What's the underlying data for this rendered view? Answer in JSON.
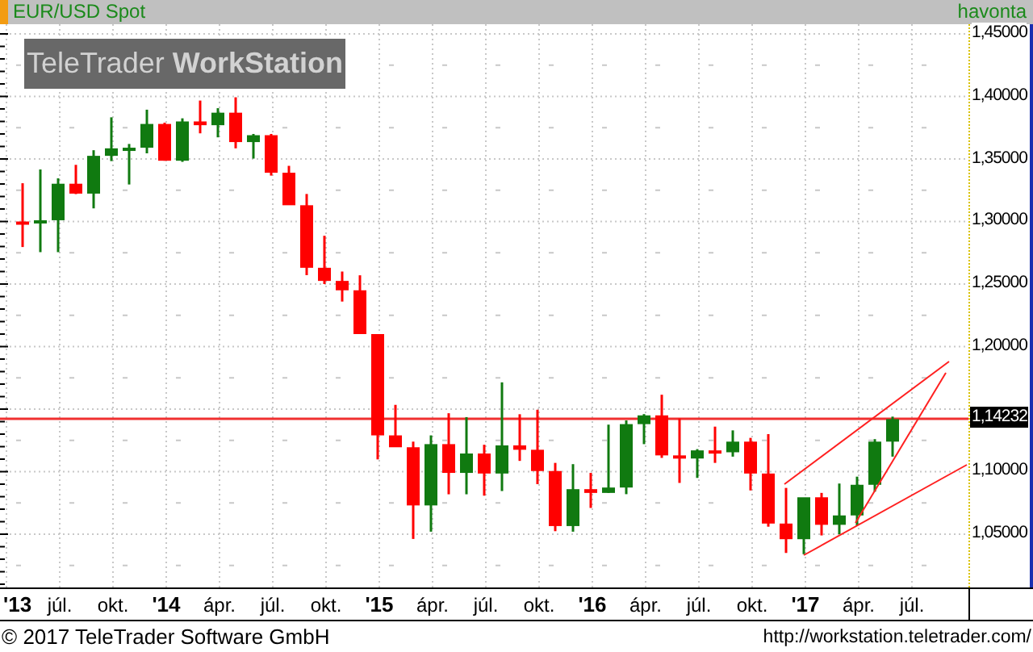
{
  "header": {
    "symbol": "EUR/USD Spot",
    "period": "havonta"
  },
  "logo": {
    "text": "TeleTrader **WorkStation**"
  },
  "y_axis": {
    "labels_above": [
      "1,45000",
      "1,40000",
      "1,35000",
      "1,30000",
      "1,25000",
      "1,20000"
    ],
    "labels_below": [
      "1,10000",
      "1,05000"
    ],
    "current_price": "1,14232"
  },
  "x_axis": {
    "labels": [
      {
        "text": "'13",
        "kind": "year"
      },
      {
        "text": "júl.",
        "kind": "month"
      },
      {
        "text": "okt.",
        "kind": "month"
      },
      {
        "text": "'14",
        "kind": "year"
      },
      {
        "text": "ápr.",
        "kind": "month"
      },
      {
        "text": "júl.",
        "kind": "month"
      },
      {
        "text": "okt.",
        "kind": "month"
      },
      {
        "text": "'15",
        "kind": "year"
      },
      {
        "text": "ápr.",
        "kind": "month"
      },
      {
        "text": "júl.",
        "kind": "month"
      },
      {
        "text": "okt.",
        "kind": "month"
      },
      {
        "text": "'16",
        "kind": "year"
      },
      {
        "text": "ápr.",
        "kind": "month"
      },
      {
        "text": "júl.",
        "kind": "month"
      },
      {
        "text": "okt.",
        "kind": "month"
      },
      {
        "text": "'17",
        "kind": "year"
      },
      {
        "text": "ápr.",
        "kind": "month"
      },
      {
        "text": "júl.",
        "kind": "month"
      }
    ]
  },
  "footer": {
    "copyright": "© 2017 TeleTrader Software GmbH",
    "url": "http://workstation.teletrader.com/"
  }
}
